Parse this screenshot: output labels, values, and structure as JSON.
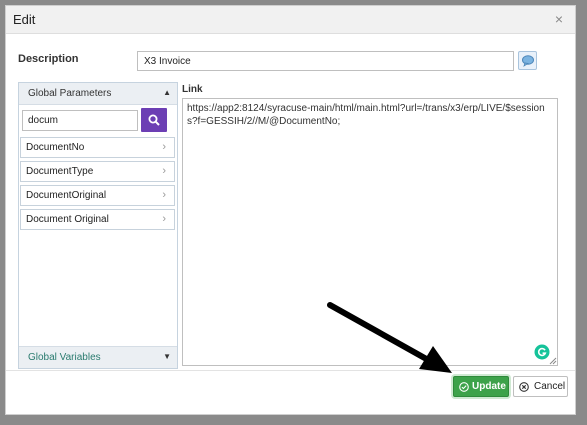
{
  "dialog": {
    "title": "Edit",
    "description_label": "Description",
    "description_value": "X3 Invoice",
    "link_label": "Link",
    "link_value": "https://app2:8124/syracuse-main/html/main.html?url=/trans/x3/erp/LIVE/$sessions?f=GESSIH/2//M/@DocumentNo;"
  },
  "left_panel": {
    "global_parameters_label": "Global Parameters",
    "search_value": "docum",
    "items": [
      {
        "label": "DocumentNo"
      },
      {
        "label": "DocumentType"
      },
      {
        "label": "DocumentOriginal"
      },
      {
        "label": "Document Original"
      }
    ],
    "global_variables_label": "Global Variables"
  },
  "buttons": {
    "update_label": "Update",
    "cancel_label": "Cancel"
  },
  "colors": {
    "search_button": "#6c3fb4",
    "update_button": "#3da24a",
    "global_variables_text": "#2a7b6f"
  },
  "icons": {
    "close": "close-icon",
    "speech": "speech-bubble-icon",
    "search": "search-icon",
    "chevron": "chevron-right-icon",
    "update": "check-circle-icon",
    "cancel": "x-circle-icon",
    "grammarly": "grammarly-icon"
  }
}
